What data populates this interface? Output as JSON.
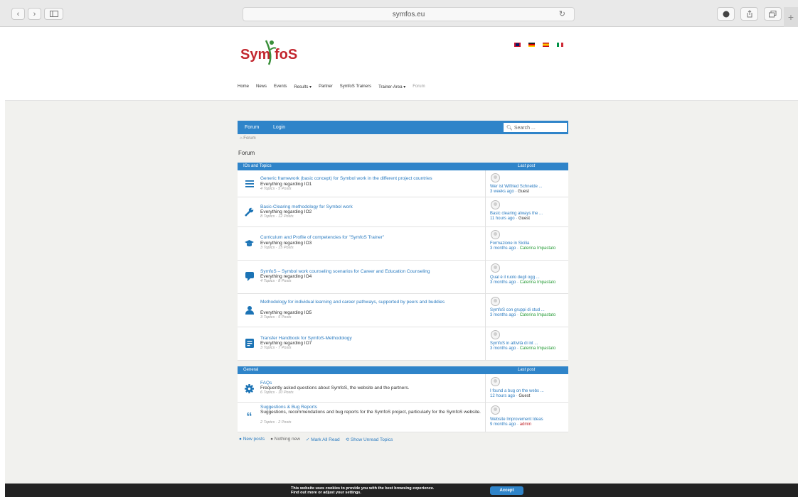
{
  "browser": {
    "back": "‹",
    "forward": "›",
    "url": "symfos.eu",
    "plus": "+"
  },
  "header": {
    "logo_text_left": "Sym",
    "logo_text_right": "foS",
    "menu": [
      "Home",
      "News",
      "Events",
      "Results ▾",
      "Partner",
      "SymfoS Trainers",
      "Trainer-Area ▾",
      "Forum"
    ]
  },
  "forum_bar": {
    "forum_link": "Forum",
    "login_link": "Login",
    "search_placeholder": "Search ..."
  },
  "breadcrumb": "Forum",
  "page_heading": "Forum",
  "section1": {
    "title": "IOs and Topics",
    "last_post": "Last post",
    "rows": [
      {
        "icon": "list-icon",
        "title": "Generic framework (basic concept) for Symbol work in the different project countries",
        "desc": "Everything regarding IO1",
        "meta": "4 Topics · 5 Posts",
        "lp_title": "Wer ist Wilfried Schneide ...",
        "lp_time": "3 weeks ago",
        "lp_user": "Guest"
      },
      {
        "icon": "wrench-icon",
        "title": "Basic-Clearing methodology for Symbol work",
        "desc": "Everything regarding IO2",
        "meta": "8 Topics · 12 Posts",
        "lp_title": "Basic clearing always the ...",
        "lp_time": "11 hours ago",
        "lp_user": "Guest"
      },
      {
        "icon": "graduation-cap-icon",
        "title": "Curriculum and Profile of competencies for \"SymfoS Trainer\"",
        "desc": "Everything regarding IO3",
        "meta": "3 Topics · 15 Posts",
        "lp_title": "Formazione in Sicilia",
        "lp_time": "3 months ago",
        "lp_user": "Caterina Impastato"
      },
      {
        "icon": "speech-bubble-icon",
        "title": "SymfoS – Symbol work counseling scenarios for Career and Education Counseling",
        "desc": "Everything regarding IO4",
        "meta": "4 Topics · 8 Posts",
        "lp_title": "Qual è il ruolo degli ogg ...",
        "lp_time": "3 months ago",
        "lp_user": "Caterina Impastato"
      },
      {
        "icon": "user-icon",
        "title": "Methodology for individual learning and career pathways, supported by peers and buddies",
        "desc": "Everything regarding IO5",
        "meta": "3 Topics · 5 Posts",
        "lp_title": "SymfoS con gruppi di stud ...",
        "lp_time": "3 months ago",
        "lp_user": "Caterina Impastato"
      },
      {
        "icon": "document-icon",
        "title": "Transfer Handbook for SymfoS-Methodology",
        "desc": "Everything regarding IO7",
        "meta": "3 Topics · 7 Posts",
        "lp_title": "SymfoS in attività di int ...",
        "lp_time": "3 months ago",
        "lp_user": "Caterina Impastato"
      }
    ]
  },
  "section2": {
    "title": "General",
    "last_post": "Last post",
    "rows": [
      {
        "icon": "gear-icon",
        "title": "FAQs",
        "desc": "Frequently asked questions about SymfoS, the website and the partners.",
        "meta": "6 Topics · 10 Posts",
        "lp_title": "I found a bug on the webs ...",
        "lp_time": "12 hours ago",
        "lp_user": "Guest"
      },
      {
        "icon": "quote-icon",
        "title": "Suggestions & Bug Reports",
        "desc": "Suggestions, recommendations and bug reports for the SymfoS project, particularly for the SymfoS website.",
        "meta": "2 Topics · 2 Posts",
        "lp_title": "Website Improvement Ideas",
        "lp_time": "9 months ago",
        "lp_user": "admin"
      }
    ]
  },
  "legend": {
    "new_posts": "● New posts",
    "nothing_new": "● Nothing new",
    "mark_read": "✓ Mark All Read",
    "show_unread": "⟲ Show Unread Topics"
  },
  "cookie": {
    "line1": "This website uses cookies to provide you with the best browsing experience.",
    "line2": "Find out more or adjust your settings.",
    "accept": "Accept"
  },
  "colors": {
    "accent": "#2f84c9",
    "brand": "#c2262e",
    "green_user": "#2a9d3a"
  }
}
